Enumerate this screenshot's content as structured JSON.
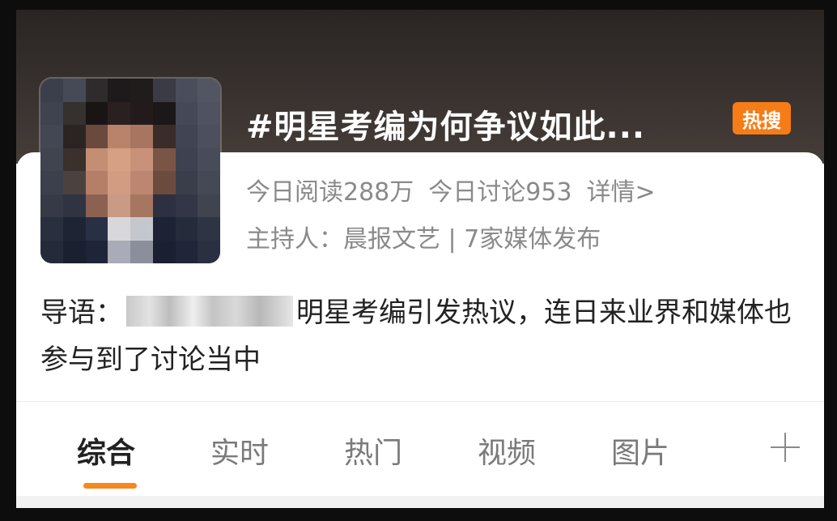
{
  "topic": {
    "title": "#明星考编为何争议如此...",
    "badge": "热搜",
    "read_stat": "今日阅读288万",
    "discussion_stat": "今日讨论953",
    "details_link": "详情>",
    "host_line": "主持人：晨报文艺 | 7家媒体发布"
  },
  "intro": {
    "label": "导语：",
    "text": "明星考编引发热议，连日来业界和媒体也参与到了讨论当中"
  },
  "tabs": [
    {
      "label": "综合",
      "active": true
    },
    {
      "label": "实时",
      "active": false
    },
    {
      "label": "热门",
      "active": false
    },
    {
      "label": "视频",
      "active": false
    },
    {
      "label": "图片",
      "active": false
    }
  ],
  "icons": {
    "avatar": "pixelated-avatar",
    "add": "plus-icon"
  },
  "colors": {
    "accent": "#f5881e",
    "badge": "#f57c16",
    "header_bg": "#2a2523"
  }
}
